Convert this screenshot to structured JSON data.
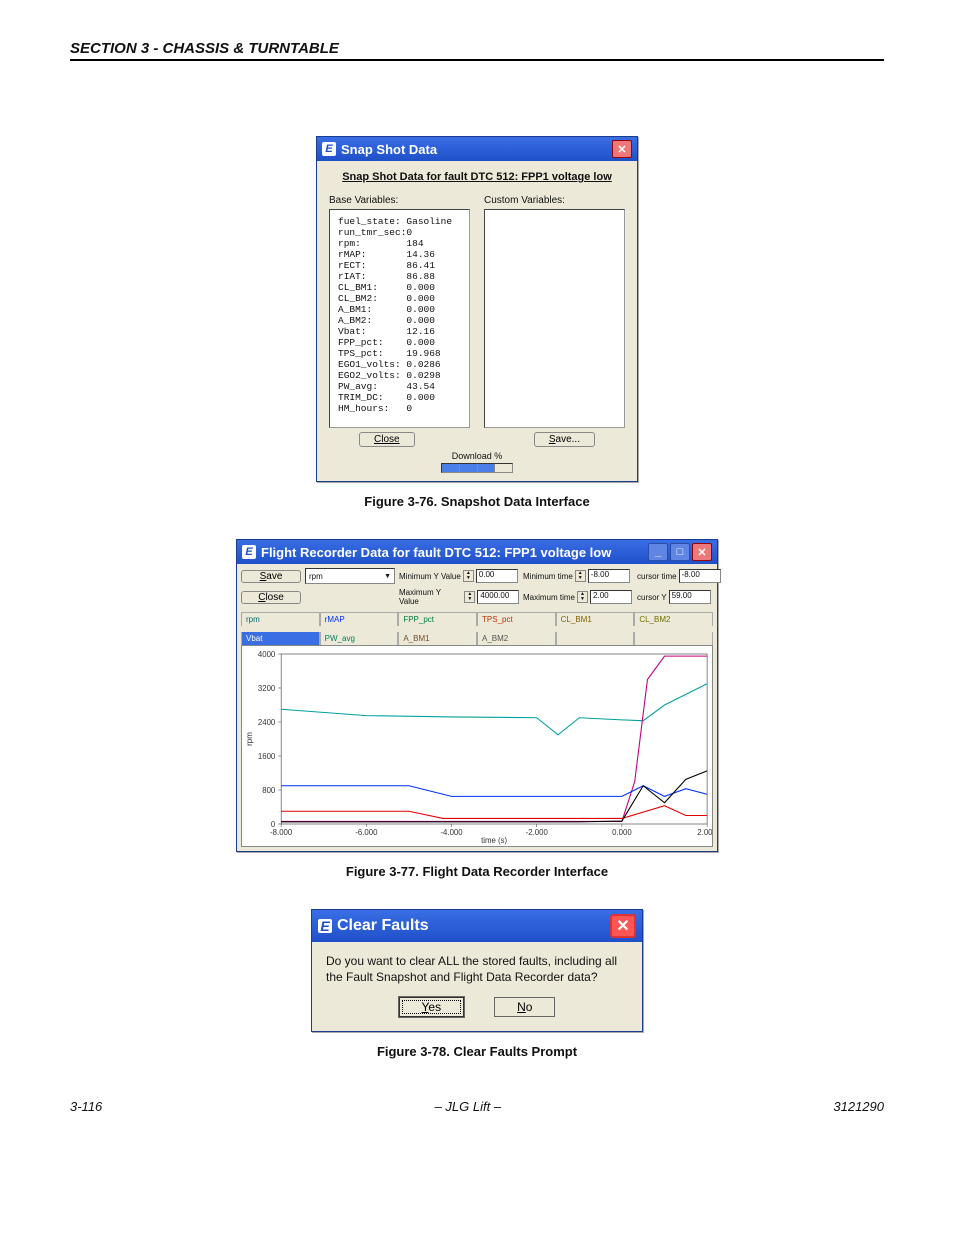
{
  "page": {
    "section_header": "SECTION 3 - CHASSIS & TURNTABLE",
    "footer_left": "3-116",
    "footer_center": "– JLG Lift –",
    "footer_right": "3121290"
  },
  "captions": {
    "fig76": "Figure 3-76.  Snapshot Data Interface",
    "fig77": "Figure 3-77.  Flight Data Recorder Interface",
    "fig78": "Figure 3-78.  Clear Faults Prompt"
  },
  "snapshot": {
    "window_title": "Snap Shot Data",
    "heading": "Snap Shot Data for fault DTC 512: FPP1 voltage low",
    "base_label": "Base Variables:",
    "custom_label": "Custom Variables:",
    "base_vars": [
      [
        "fuel_state:",
        "Gasoline"
      ],
      [
        "run_tmr_sec:",
        "0"
      ],
      [
        "rpm:",
        "184"
      ],
      [
        "rMAP:",
        "14.36"
      ],
      [
        "rECT:",
        "86.41"
      ],
      [
        "rIAT:",
        "86.88"
      ],
      [
        "CL_BM1:",
        "0.000"
      ],
      [
        "CL_BM2:",
        "0.000"
      ],
      [
        "A_BM1:",
        "0.000"
      ],
      [
        "A_BM2:",
        "0.000"
      ],
      [
        "Vbat:",
        "12.16"
      ],
      [
        "FPP_pct:",
        "0.000"
      ],
      [
        "TPS_pct:",
        "19.968"
      ],
      [
        "EGO1_volts:",
        "0.0286"
      ],
      [
        "EGO2_volts:",
        "0.0298"
      ],
      [
        "PW_avg:",
        "43.54"
      ],
      [
        "TRIM_DC:",
        "0.000"
      ],
      [
        "HM_hours:",
        "0"
      ]
    ],
    "btn_close": "Close",
    "btn_save": "Save...",
    "download_label": "Download %"
  },
  "flight": {
    "window_title": "Flight Recorder Data for fault DTC 512: FPP1 voltage low",
    "btn_save": "Save",
    "btn_close": "Close",
    "select_value": "rpm",
    "min_y_lbl": "Minimum Y Value",
    "min_y_val": "0.00",
    "max_y_lbl": "Maximum Y Value",
    "max_y_val": "4000.00",
    "min_t_lbl": "Minimum time",
    "min_t_val": "-8.00",
    "max_t_lbl": "Maximum time",
    "max_t_val": "2.00",
    "cur_x_lbl": "cursor time",
    "cur_x_val": "-8.00",
    "cur_y_lbl": "cursor Y",
    "cur_y_val": "59.00",
    "tabs_row1": [
      "rpm",
      "rMAP",
      "FPP_pct",
      "TPS_pct",
      "CL_BM1",
      "CL_BM2"
    ],
    "tabs_row2": [
      "Vbat",
      "PW_avg",
      "A_BM1",
      "A_BM2",
      "",
      ""
    ],
    "chart_xlabel": "time (s)"
  },
  "chart_data": {
    "type": "line",
    "xlabel": "time (s)",
    "ylabel": "rpm",
    "xlim": [
      -8,
      2
    ],
    "ylim": [
      0,
      4000
    ],
    "x_ticks": [
      -8.0,
      -6.0,
      -4.0,
      -2.0,
      0.0,
      2.0
    ],
    "y_ticks": [
      0,
      800,
      1600,
      2400,
      3200,
      4000
    ],
    "series": [
      {
        "name": "rpm",
        "color": "#00a0a0",
        "x": [
          -8,
          -6,
          -4,
          -2,
          -1.5,
          -1,
          0,
          0.5,
          1,
          2
        ],
        "y": [
          2700,
          2550,
          2520,
          2500,
          2100,
          2500,
          2450,
          2430,
          2800,
          3300
        ]
      },
      {
        "name": "rMAP",
        "color": "#c00080",
        "x": [
          -8,
          -4,
          -2,
          0,
          0.3,
          0.6,
          1,
          2
        ],
        "y": [
          60,
          60,
          60,
          60,
          1000,
          3400,
          3950,
          3950
        ]
      },
      {
        "name": "FPP_pct",
        "color": "#0030ff",
        "x": [
          -8,
          -5,
          -4,
          -2,
          0,
          0.5,
          1,
          1.5,
          2
        ],
        "y": [
          900,
          900,
          650,
          650,
          650,
          900,
          650,
          830,
          700
        ]
      },
      {
        "name": "TPS_pct",
        "color": "#e00000",
        "x": [
          -8,
          -5,
          -4.2,
          -2,
          0,
          1,
          1.5,
          2
        ],
        "y": [
          300,
          300,
          130,
          130,
          130,
          430,
          200,
          200
        ]
      },
      {
        "name": "CL_BM1",
        "color": "#000000",
        "x": [
          -8,
          -2,
          -1,
          0,
          0.5,
          1,
          1.5,
          2
        ],
        "y": [
          50,
          50,
          50,
          70,
          900,
          500,
          1050,
          1250
        ]
      }
    ]
  },
  "clear_faults": {
    "title": "Clear Faults",
    "text": "Do you want to clear ALL the stored faults, including all the Fault Snapshot and Flight Data Recorder data?",
    "yes": "Yes",
    "no": "No"
  }
}
